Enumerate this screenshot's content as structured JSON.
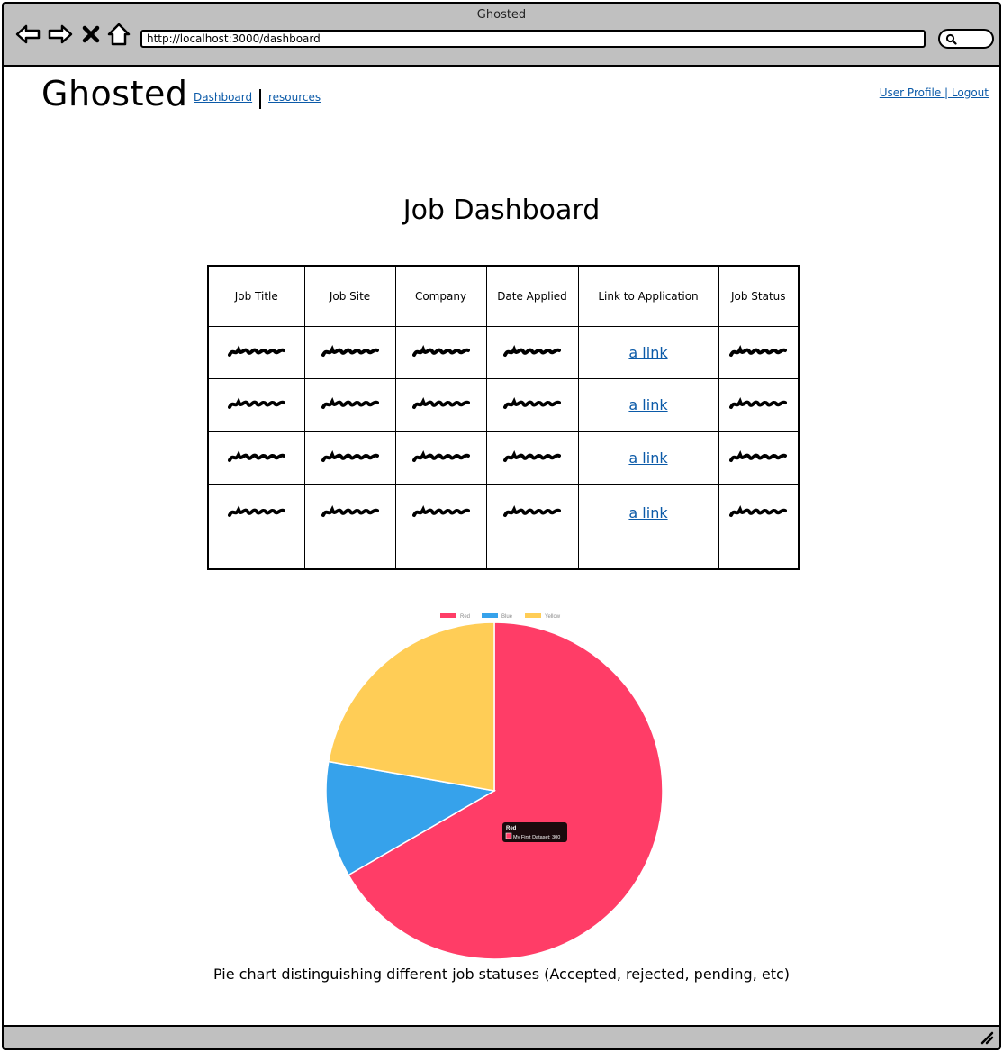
{
  "window": {
    "title": "Ghosted",
    "url": "http://localhost:3000/dashboard"
  },
  "icons": {
    "back": "back-arrow-icon",
    "forward": "forward-arrow-icon",
    "stop": "close-x-icon",
    "home": "home-icon",
    "search": "search-icon",
    "resize": "resize-grip-icon"
  },
  "header": {
    "brand": "Ghosted",
    "nav": [
      {
        "label": "Dashboard"
      },
      {
        "label": "resources"
      }
    ],
    "user_links": "User Profile | Logout"
  },
  "main": {
    "title": "Job Dashboard",
    "table": {
      "columns": [
        "Job Title",
        "Job Site",
        "Company",
        "Date Applied",
        "Link to Application",
        "Job Status"
      ],
      "rows": [
        {
          "link": "a link"
        },
        {
          "link": "a link"
        },
        {
          "link": "a link"
        },
        {
          "link": "a link"
        }
      ]
    },
    "caption": "Pie chart distinguishing different job statuses (Accepted, rejected, pending, etc)"
  },
  "chart_data": {
    "type": "pie",
    "categories": [
      "Red",
      "Blue",
      "Yellow"
    ],
    "series": [
      {
        "name": "My First Dataset",
        "values": [
          300,
          50,
          100
        ]
      }
    ],
    "colors": [
      "#ff3d67",
      "#36a2eb",
      "#ffcd56"
    ],
    "legend": "top",
    "tooltip": {
      "title": "Red",
      "label": "My First Dataset: 300"
    }
  }
}
